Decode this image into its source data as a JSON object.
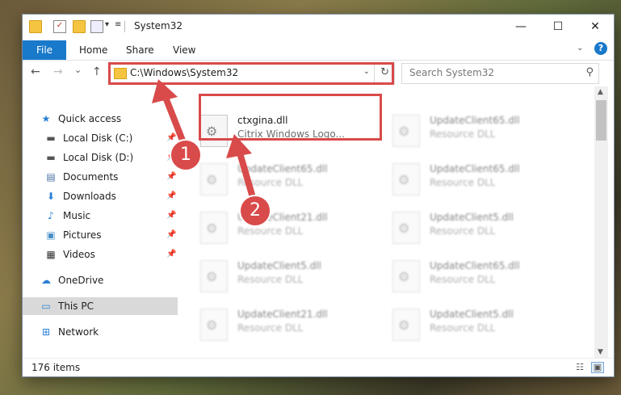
{
  "window": {
    "title": "System32",
    "controls": {
      "minimize": "—",
      "maximize": "☐",
      "close": "✕"
    }
  },
  "ribbon": {
    "tabs": [
      "File",
      "Home",
      "Share",
      "View"
    ],
    "help": "?"
  },
  "nav": {
    "back": "←",
    "forward": "→",
    "recent": "⌄",
    "up": "↑",
    "address": "C:\\Windows\\System32",
    "search_placeholder": "Search System32"
  },
  "sidebar": {
    "items": [
      {
        "label": "Quick access",
        "icon": "star-icon",
        "glyph": "★",
        "color": "#2a7fd4",
        "pinned": false
      },
      {
        "label": "Local Disk (C:)",
        "icon": "drive-icon",
        "glyph": "▬",
        "color": "#555555",
        "pinned": true
      },
      {
        "label": "Local Disk (D:)",
        "icon": "drive-icon",
        "glyph": "▬",
        "color": "#555555",
        "pinned": true
      },
      {
        "label": "Documents",
        "icon": "documents-icon",
        "glyph": "▤",
        "color": "#4a6fa5",
        "pinned": true
      },
      {
        "label": "Downloads",
        "icon": "download-icon",
        "glyph": "⬇",
        "color": "#2a7fd4",
        "pinned": true
      },
      {
        "label": "Music",
        "icon": "music-icon",
        "glyph": "♪",
        "color": "#2a7fd4",
        "pinned": true
      },
      {
        "label": "Pictures",
        "icon": "pictures-icon",
        "glyph": "▣",
        "color": "#4a8fc5",
        "pinned": true
      },
      {
        "label": "Videos",
        "icon": "video-icon",
        "glyph": "▦",
        "color": "#333333",
        "pinned": true
      },
      {
        "label": "OneDrive",
        "icon": "cloud-icon",
        "glyph": "☁",
        "color": "#2a7fd4",
        "pinned": false
      },
      {
        "label": "This PC",
        "icon": "computer-icon",
        "glyph": "▭",
        "color": "#2a7fd4",
        "pinned": false,
        "selected": true
      },
      {
        "label": "Network",
        "icon": "network-icon",
        "glyph": "⊞",
        "color": "#2a7fd4",
        "pinned": false
      }
    ],
    "pin_glyph": "📌"
  },
  "files": [
    {
      "name": "ctxgina.dll",
      "desc": "Citrix Windows Logo...",
      "highlight": true
    },
    {
      "name": "UpdateClient65.dll",
      "desc": "Resource DLL"
    },
    {
      "name": "UpdateClient65.dll",
      "desc": "Resource DLL"
    },
    {
      "name": "UpdateClient65.dll",
      "desc": "Resource DLL"
    },
    {
      "name": "UpdateClient21.dll",
      "desc": "Resource DLL"
    },
    {
      "name": "UpdateClient5.dll",
      "desc": "Resource DLL"
    },
    {
      "name": "UpdateClient5.dll",
      "desc": "Resource DLL"
    },
    {
      "name": "UpdateClient65.dll",
      "desc": "Resource DLL"
    },
    {
      "name": "UpdateClient21.dll",
      "desc": "Resource DLL"
    },
    {
      "name": "UpdateClient5.dll",
      "desc": "Resource DLL"
    }
  ],
  "status": {
    "items": "176 items"
  },
  "annotations": {
    "step1": "1",
    "step2": "2",
    "color": "#d94a4a"
  }
}
